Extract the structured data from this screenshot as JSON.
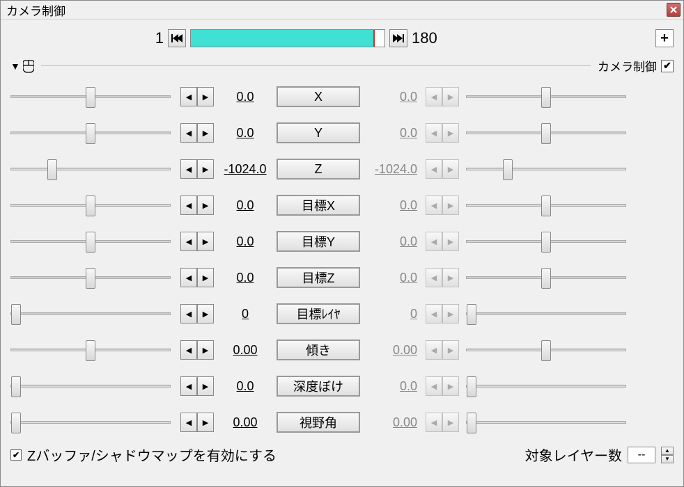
{
  "window": {
    "title": "カメラ制御"
  },
  "timeline": {
    "start": "1",
    "end": "180",
    "fill_percent": 95
  },
  "section": {
    "label": "カメラ制御",
    "checked": "✔"
  },
  "params": [
    {
      "label": "X",
      "left_val": "0.0",
      "right_val": "0.0",
      "left_thumb": 50,
      "right_thumb": 50,
      "right_disabled": true
    },
    {
      "label": "Y",
      "left_val": "0.0",
      "right_val": "0.0",
      "left_thumb": 50,
      "right_thumb": 50,
      "right_disabled": true
    },
    {
      "label": "Z",
      "left_val": "-1024.0",
      "right_val": "-1024.0",
      "left_thumb": 26,
      "right_thumb": 26,
      "right_disabled": true
    },
    {
      "label": "目標X",
      "left_val": "0.0",
      "right_val": "0.0",
      "left_thumb": 50,
      "right_thumb": 50,
      "right_disabled": true
    },
    {
      "label": "目標Y",
      "left_val": "0.0",
      "right_val": "0.0",
      "left_thumb": 50,
      "right_thumb": 50,
      "right_disabled": true
    },
    {
      "label": "目標Z",
      "left_val": "0.0",
      "right_val": "0.0",
      "left_thumb": 50,
      "right_thumb": 50,
      "right_disabled": true
    },
    {
      "label": "目標ﾚｲﾔ",
      "left_val": "0",
      "right_val": "0",
      "left_thumb": 3,
      "right_thumb": 3,
      "right_disabled": true
    },
    {
      "label": "傾き",
      "left_val": "0.00",
      "right_val": "0.00",
      "left_thumb": 50,
      "right_thumb": 50,
      "right_disabled": true
    },
    {
      "label": "深度ぼけ",
      "left_val": "0.0",
      "right_val": "0.0",
      "left_thumb": 3,
      "right_thumb": 3,
      "right_disabled": true
    },
    {
      "label": "視野角",
      "left_val": "0.00",
      "right_val": "0.00",
      "left_thumb": 3,
      "right_thumb": 3,
      "right_disabled": true
    }
  ],
  "bottom": {
    "zbuffer_checked": "✔",
    "zbuffer_label": "Zバッファ/シャドウマップを有効にする",
    "layer_label": "対象レイヤー数",
    "layer_value": "--"
  }
}
